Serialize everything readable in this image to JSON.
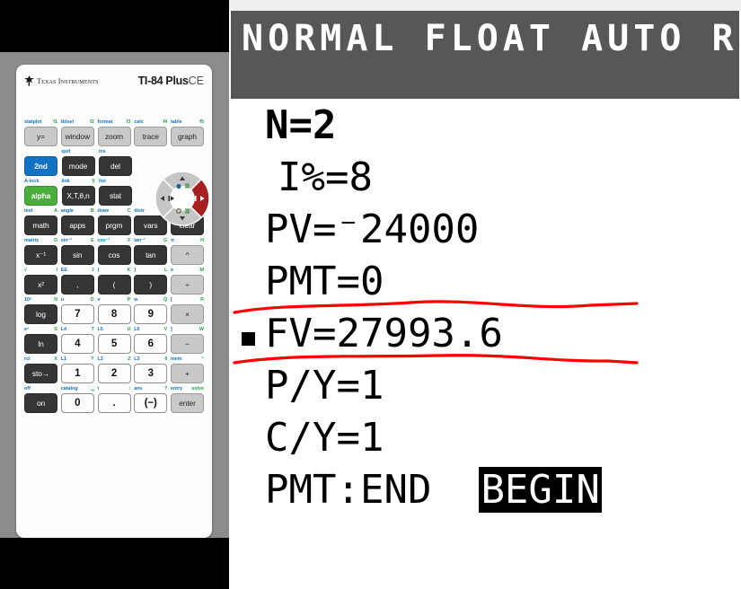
{
  "device": {
    "brand_mark": "ti-logo",
    "brand_name": "Texas Instruments",
    "model_bold": "TI-84 Plus",
    "model_suffix": "CE"
  },
  "screen": {
    "status_bar": "NORMAL FLOAT AUTO REAL",
    "status_bg": "#575757",
    "status_fg": "#ffffff",
    "annotation_color": "#ff0000",
    "solve_marker": "■",
    "lines": [
      {
        "name": "n",
        "text": "N=2",
        "bold": true,
        "indent": false,
        "selected": false
      },
      {
        "name": "interest",
        "text": "I%=8",
        "bold": false,
        "indent": true,
        "selected": false
      },
      {
        "name": "pv",
        "text": "PV=⁻24000",
        "bold": false,
        "indent": false,
        "selected": false
      },
      {
        "name": "pmt",
        "text": "PMT=0",
        "bold": false,
        "indent": false,
        "selected": false
      },
      {
        "name": "fv",
        "text": "FV=27993.6",
        "bold": false,
        "indent": false,
        "selected": true
      },
      {
        "name": "py",
        "text": "P∕Y=1",
        "bold": false,
        "indent": false,
        "selected": false
      },
      {
        "name": "cy",
        "text": "C∕Y=1",
        "bold": false,
        "indent": false,
        "selected": false
      }
    ],
    "pmt_row": {
      "label": "PMT:",
      "option_end": "END",
      "option_begin": "BEGIN",
      "selected_option": "BEGIN"
    }
  },
  "tvm_values": {
    "N": "2",
    "I_percent": "8",
    "PV": "-24000",
    "PMT": "0",
    "FV": "27993.6",
    "P_per_Y": "1",
    "C_per_Y": "1",
    "PMT_timing": "BEGIN"
  },
  "keypad": {
    "rows": [
      {
        "name": "function-row",
        "keys": [
          {
            "name": "y-equals",
            "label": "y=",
            "style": "gray",
            "second": "statplot",
            "alpha": "f1"
          },
          {
            "name": "window",
            "label": "window",
            "style": "gray",
            "second": "tblset",
            "alpha": "f2"
          },
          {
            "name": "zoom",
            "label": "zoom",
            "style": "gray",
            "second": "format",
            "alpha": "f3"
          },
          {
            "name": "trace",
            "label": "trace",
            "style": "gray",
            "second": "calc",
            "alpha": "f4"
          },
          {
            "name": "graph",
            "label": "graph",
            "style": "gray",
            "second": "table",
            "alpha": "f5"
          }
        ]
      },
      {
        "name": "second-mode-del-row",
        "keys": [
          {
            "name": "second",
            "label": "2nd",
            "style": "blue",
            "second": "",
            "alpha": ""
          },
          {
            "name": "mode",
            "label": "mode",
            "style": "dark",
            "second": "quit",
            "alpha": ""
          },
          {
            "name": "delete",
            "label": "del",
            "style": "dark",
            "second": "ins",
            "alpha": ""
          }
        ]
      },
      {
        "name": "alpha-xton-stat-row",
        "keys": [
          {
            "name": "alpha",
            "label": "alpha",
            "style": "green",
            "second": "A-lock",
            "alpha": ""
          },
          {
            "name": "x-t-theta-n",
            "label": "X,T,θ,n",
            "style": "dark",
            "second": "link",
            "alpha": "§"
          },
          {
            "name": "stat",
            "label": "stat",
            "style": "dark",
            "second": "list",
            "alpha": ""
          }
        ]
      },
      {
        "name": "math-row",
        "keys": [
          {
            "name": "math",
            "label": "math",
            "style": "dark",
            "second": "test",
            "alpha": "A"
          },
          {
            "name": "apps",
            "label": "apps",
            "style": "dark",
            "second": "angle",
            "alpha": "B"
          },
          {
            "name": "prgm",
            "label": "prgm",
            "style": "dark",
            "second": "draw",
            "alpha": "C"
          },
          {
            "name": "vars",
            "label": "vars",
            "style": "dark",
            "second": "distr",
            "alpha": ""
          },
          {
            "name": "clear",
            "label": "clear",
            "style": "dark",
            "second": "",
            "alpha": ""
          }
        ]
      },
      {
        "name": "trig-row",
        "keys": [
          {
            "name": "reciprocal",
            "label": "x⁻¹",
            "style": "dark",
            "second": "matrix",
            "alpha": "D"
          },
          {
            "name": "sine",
            "label": "sin",
            "style": "dark",
            "second": "sin⁻¹",
            "alpha": "E"
          },
          {
            "name": "cosine",
            "label": "cos",
            "style": "dark",
            "second": "cos⁻¹",
            "alpha": "F"
          },
          {
            "name": "tangent",
            "label": "tan",
            "style": "dark",
            "second": "tan⁻¹",
            "alpha": "G"
          },
          {
            "name": "power",
            "label": "^",
            "style": "gray",
            "second": "π",
            "alpha": "H"
          }
        ]
      },
      {
        "name": "square-paren-divide-row",
        "keys": [
          {
            "name": "square",
            "label": "x²",
            "style": "dark",
            "second": "√",
            "alpha": "I"
          },
          {
            "name": "comma",
            "label": ",",
            "style": "dark",
            "second": "EE",
            "alpha": "J"
          },
          {
            "name": "open-paren",
            "label": "(",
            "style": "dark",
            "second": "{",
            "alpha": "K"
          },
          {
            "name": "close-paren",
            "label": ")",
            "style": "dark",
            "second": "}",
            "alpha": "L"
          },
          {
            "name": "divide",
            "label": "÷",
            "style": "gray",
            "second": "e",
            "alpha": "M"
          }
        ]
      },
      {
        "name": "log-789-multiply-row",
        "keys": [
          {
            "name": "log",
            "label": "log",
            "style": "dark",
            "second": "10ˣ",
            "alpha": "N"
          },
          {
            "name": "seven",
            "label": "7",
            "style": "white",
            "second": "u",
            "alpha": "O"
          },
          {
            "name": "eight",
            "label": "8",
            "style": "white",
            "second": "v",
            "alpha": "P"
          },
          {
            "name": "nine",
            "label": "9",
            "style": "white",
            "second": "w",
            "alpha": "Q"
          },
          {
            "name": "multiply",
            "label": "×",
            "style": "gray",
            "second": "[",
            "alpha": "R"
          }
        ]
      },
      {
        "name": "ln-456-minus-row",
        "keys": [
          {
            "name": "natural-log",
            "label": "ln",
            "style": "dark",
            "second": "eˣ",
            "alpha": "S"
          },
          {
            "name": "four",
            "label": "4",
            "style": "white",
            "second": "L4",
            "alpha": "T"
          },
          {
            "name": "five",
            "label": "5",
            "style": "white",
            "second": "L5",
            "alpha": "U"
          },
          {
            "name": "six",
            "label": "6",
            "style": "white",
            "second": "L6",
            "alpha": "V"
          },
          {
            "name": "subtract",
            "label": "−",
            "style": "gray",
            "second": "]",
            "alpha": "W"
          }
        ]
      },
      {
        "name": "sto-123-plus-row",
        "keys": [
          {
            "name": "store",
            "label": "sto→",
            "style": "dark",
            "second": "rcl",
            "alpha": "X"
          },
          {
            "name": "one",
            "label": "1",
            "style": "white",
            "second": "L1",
            "alpha": "Y"
          },
          {
            "name": "two",
            "label": "2",
            "style": "white",
            "second": "L2",
            "alpha": "Z"
          },
          {
            "name": "three",
            "label": "3",
            "style": "white",
            "second": "L3",
            "alpha": "θ"
          },
          {
            "name": "add",
            "label": "+",
            "style": "gray",
            "second": "mem",
            "alpha": "“"
          }
        ]
      },
      {
        "name": "on-0-dot-negate-enter-row",
        "keys": [
          {
            "name": "on",
            "label": "on",
            "style": "dark",
            "second": "off",
            "alpha": ""
          },
          {
            "name": "zero",
            "label": "0",
            "style": "white",
            "second": "catalog",
            "alpha": "␣"
          },
          {
            "name": "decimal",
            "label": ".",
            "style": "white",
            "second": "i",
            "alpha": ":"
          },
          {
            "name": "negate",
            "label": "(−)",
            "style": "white",
            "second": "ans",
            "alpha": "?"
          },
          {
            "name": "enter",
            "label": "enter",
            "style": "gray",
            "second": "entry",
            "alpha": "solve"
          }
        ]
      }
    ],
    "dpad": {
      "name": "directional-pad",
      "up": "up-arrow",
      "down": "down-arrow",
      "left": "left-arrow",
      "right": "right-arrow",
      "right_highlighted": true,
      "highlight_color": "#a81f22",
      "base_color": "#c6c6c6"
    }
  }
}
